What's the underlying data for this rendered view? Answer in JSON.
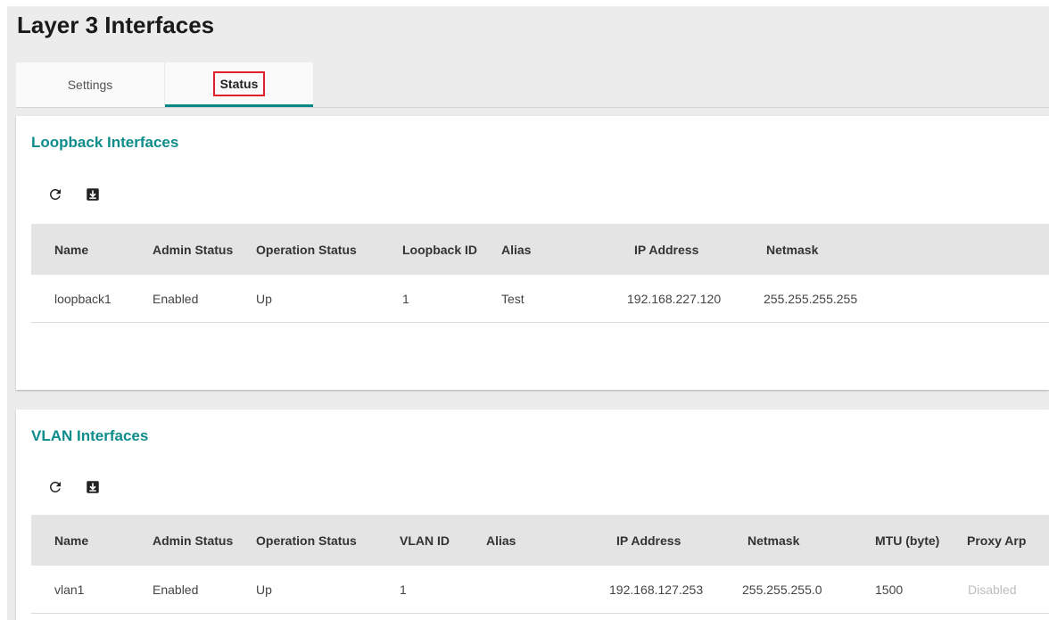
{
  "page": {
    "title": "Layer 3 Interfaces"
  },
  "tabs": [
    {
      "label": "Settings",
      "active": false
    },
    {
      "label": "Status",
      "active": true
    }
  ],
  "loopback": {
    "title": "Loopback Interfaces",
    "toolbar": [
      "refresh-icon",
      "export-icon"
    ],
    "columns": [
      "Name",
      "Admin Status",
      "Operation Status",
      "Loopback ID",
      "Alias",
      "IP Address",
      "Netmask"
    ],
    "rows": [
      [
        "loopback1",
        "Enabled",
        "Up",
        "1",
        "Test",
        "192.168.227.120",
        "255.255.255.255"
      ]
    ]
  },
  "vlan": {
    "title": "VLAN Interfaces",
    "toolbar": [
      "refresh-icon",
      "export-icon"
    ],
    "columns": [
      "Name",
      "Admin Status",
      "Operation Status",
      "VLAN ID",
      "Alias",
      "IP Address",
      "Netmask",
      "MTU (byte)",
      "Proxy Arp"
    ],
    "rows": [
      [
        "vlan1",
        "Enabled",
        "Up",
        "1",
        "",
        "192.168.127.253",
        "255.255.255.0",
        "1500",
        "Disabled"
      ]
    ]
  },
  "colors": {
    "accent": "#0e8c8c",
    "tab_underline": "#008787",
    "highlight_box": "#e0212a"
  }
}
